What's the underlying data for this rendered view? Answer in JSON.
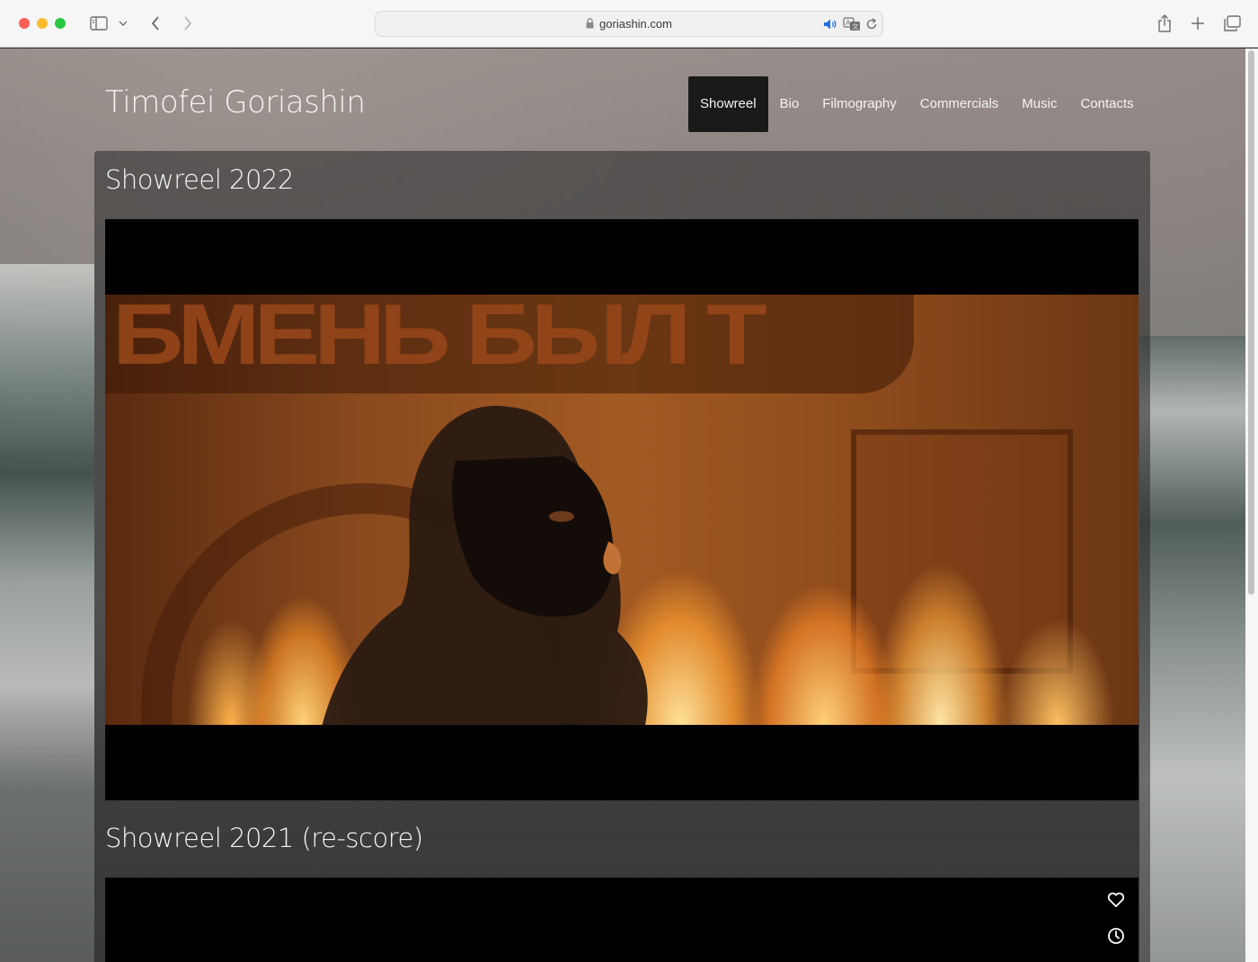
{
  "browser": {
    "url": "goriashin.com"
  },
  "site": {
    "title": "Timofei Goriashin",
    "menu": [
      {
        "label": "Showreel",
        "active": true
      },
      {
        "label": "Bio",
        "active": false
      },
      {
        "label": "Filmography",
        "active": false
      },
      {
        "label": "Commercials",
        "active": false
      },
      {
        "label": "Music",
        "active": false
      },
      {
        "label": "Contacts",
        "active": false
      }
    ]
  },
  "sections": [
    {
      "title": "Showreel 2022"
    },
    {
      "title": "Showreel 2021 (re-score)"
    }
  ],
  "video": {
    "sign_text": "БМЕНЬ БЫЛ Т"
  },
  "colors": {
    "menu_active_bg": "#1a1a1a",
    "video_bg": "#000000"
  }
}
